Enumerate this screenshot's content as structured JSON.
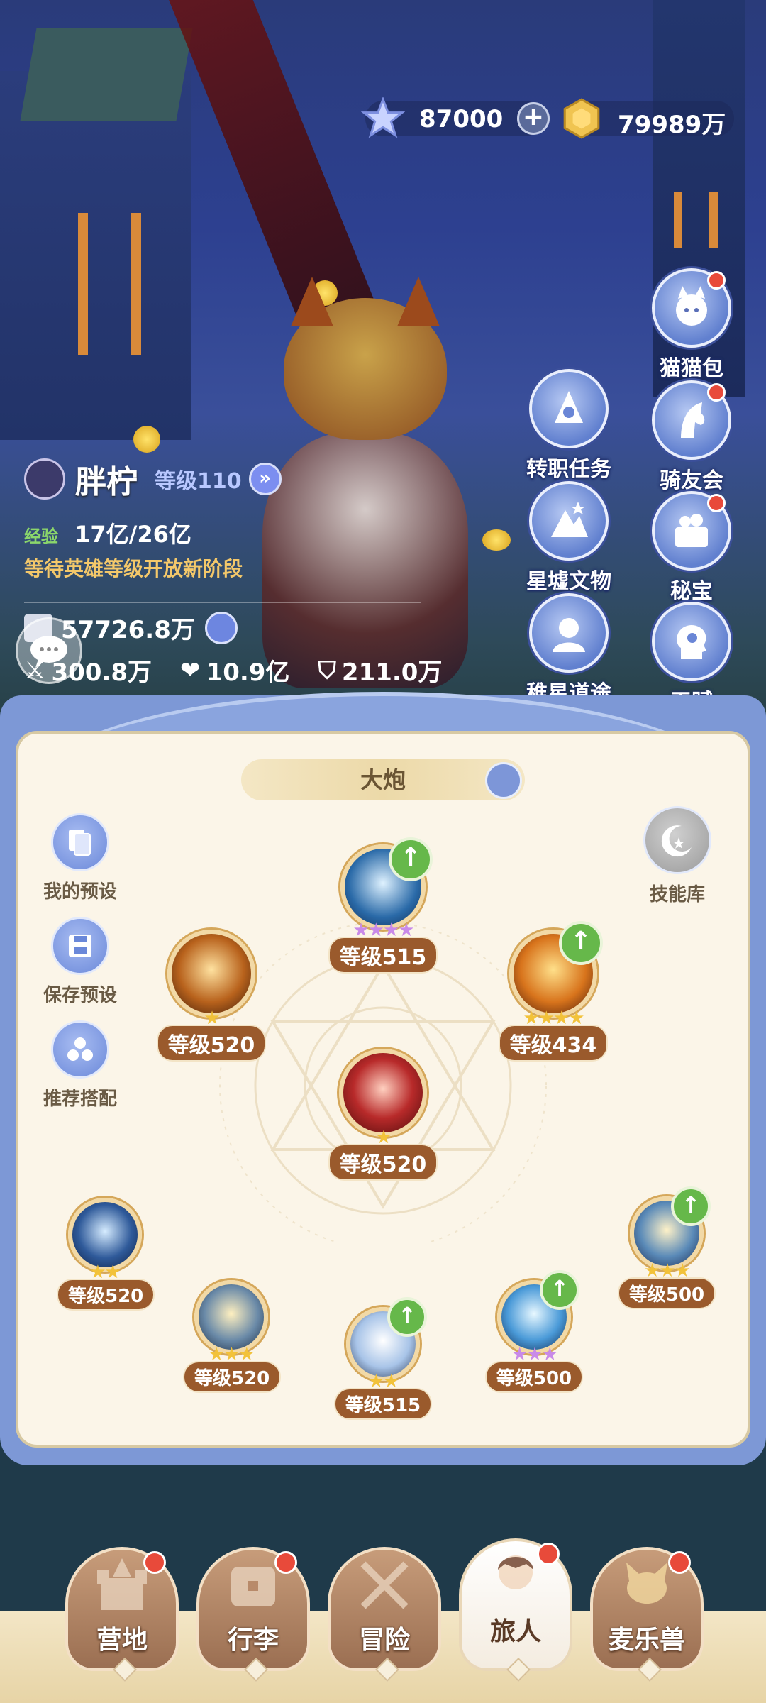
{
  "currency": {
    "gems": "87000",
    "gold": "79989万"
  },
  "features": [
    {
      "label": "猫猫包",
      "icon": "cat-bag-icon",
      "badge": true
    },
    {
      "label": "转职任务",
      "icon": "job-change-icon",
      "badge": false
    },
    {
      "label": "骑友会",
      "icon": "horse-icon",
      "badge": true
    },
    {
      "label": "星墟文物",
      "icon": "relic-icon",
      "badge": false
    },
    {
      "label": "秘宝",
      "icon": "treasure-icon",
      "badge": true
    },
    {
      "label": "稚星道途",
      "icon": "star-path-icon",
      "badge": false
    },
    {
      "label": "天赋",
      "icon": "talent-icon",
      "badge": false
    }
  ],
  "player": {
    "name": "胖柠",
    "level": "等级110",
    "exp_label": "经验",
    "exp": "17亿/26亿",
    "notice": "等待英雄等级开放新阶段",
    "power": "57726.8万",
    "attack": "300.8万",
    "hp": "10.9亿",
    "defense": "211.0万"
  },
  "panel": {
    "title": "大炮",
    "side_buttons": {
      "my_presets": "我的预设",
      "save_preset": "保存预设",
      "recommended": "推荐搭配",
      "skill_library": "技能库"
    },
    "skills": [
      {
        "level": "等级515",
        "stars": "★★★★",
        "star_color": "purple",
        "upgrade": true
      },
      {
        "level": "等级520",
        "stars": "★",
        "star_color": "gold",
        "upgrade": false
      },
      {
        "level": "等级434",
        "stars": "★★★★",
        "star_color": "gold",
        "upgrade": true
      },
      {
        "level": "等级520",
        "stars": "★",
        "star_color": "gold",
        "upgrade": false
      },
      {
        "level": "等级520",
        "stars": "★★",
        "star_color": "gold",
        "upgrade": false
      },
      {
        "level": "等级520",
        "stars": "★★★",
        "star_color": "gold",
        "upgrade": false
      },
      {
        "level": "等级515",
        "stars": "★★",
        "star_color": "gold",
        "upgrade": true
      },
      {
        "level": "等级500",
        "stars": "★★★",
        "star_color": "purple",
        "upgrade": true
      },
      {
        "level": "等级500",
        "stars": "★★★",
        "star_color": "gold",
        "upgrade": true
      }
    ]
  },
  "nav": {
    "tabs": [
      {
        "label": "营地",
        "icon": "castle-icon",
        "badge": true,
        "active": false
      },
      {
        "label": "行李",
        "icon": "chest-icon",
        "badge": true,
        "active": false
      },
      {
        "label": "冒险",
        "icon": "crossed-swords-icon",
        "badge": false,
        "active": false
      },
      {
        "label": "旅人",
        "icon": "traveler-icon",
        "badge": true,
        "active": true
      },
      {
        "label": "麦乐兽",
        "icon": "fox-pet-icon",
        "badge": true,
        "active": false
      }
    ]
  },
  "colors": {
    "accent_blue": "#6d86e0",
    "badge_red": "#e84a3a",
    "upgrade_green": "#66b84a",
    "level_brown": "#9a5a2c",
    "panel_cream": "#fbf5e8"
  }
}
